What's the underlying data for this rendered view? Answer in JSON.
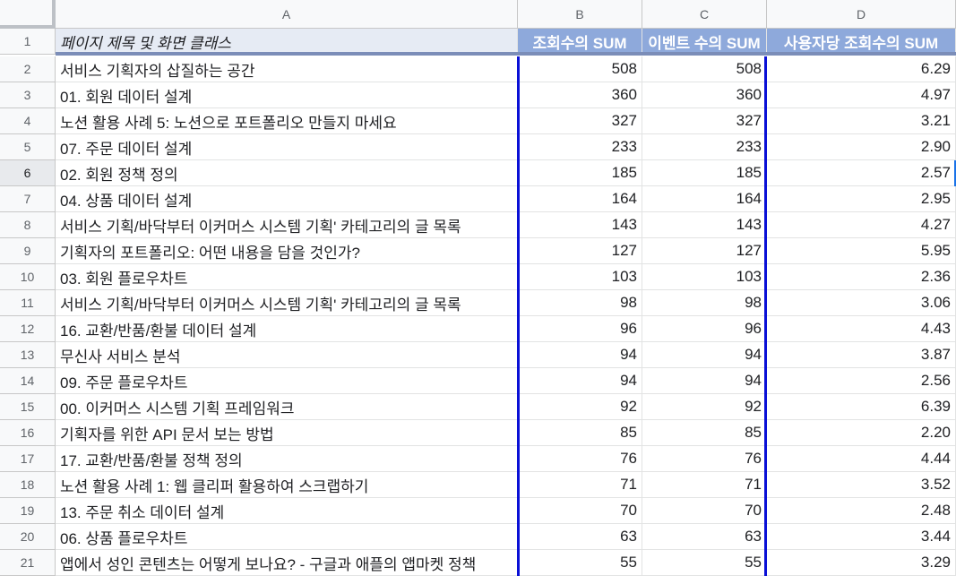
{
  "columns": [
    "A",
    "B",
    "C",
    "D"
  ],
  "header_row": {
    "row_number": "1",
    "a": "페이지 제목 및 화면 클래스",
    "b": "조회수의 SUM",
    "c": "이벤트 수의 SUM",
    "d": "사용자당 조회수의 SUM"
  },
  "rows": [
    {
      "n": "2",
      "title": "서비스 기획자의 삽질하는 공간",
      "views": "508",
      "events": "508",
      "per_user": "6.29"
    },
    {
      "n": "3",
      "title": "01. 회원 데이터 설계",
      "views": "360",
      "events": "360",
      "per_user": "4.97"
    },
    {
      "n": "4",
      "title": "노션 활용 사례 5: 노션으로 포트폴리오 만들지 마세요",
      "views": "327",
      "events": "327",
      "per_user": "3.21"
    },
    {
      "n": "5",
      "title": "07. 주문 데이터 설계",
      "views": "233",
      "events": "233",
      "per_user": "2.90"
    },
    {
      "n": "6",
      "title": "02. 회원 정책 정의",
      "views": "185",
      "events": "185",
      "per_user": "2.57"
    },
    {
      "n": "7",
      "title": "04. 상품 데이터 설계",
      "views": "164",
      "events": "164",
      "per_user": "2.95"
    },
    {
      "n": "8",
      "title": "서비스 기획/바닥부터 이커머스 시스템 기획' 카테고리의 글 목록",
      "views": "143",
      "events": "143",
      "per_user": "4.27"
    },
    {
      "n": "9",
      "title": "기획자의 포트폴리오: 어떤 내용을 담을 것인가?",
      "views": "127",
      "events": "127",
      "per_user": "5.95"
    },
    {
      "n": "10",
      "title": "03. 회원 플로우차트",
      "views": "103",
      "events": "103",
      "per_user": "2.36"
    },
    {
      "n": "11",
      "title": "서비스 기획/바닥부터 이커머스 시스템 기획' 카테고리의 글 목록",
      "views": "98",
      "events": "98",
      "per_user": "3.06"
    },
    {
      "n": "12",
      "title": "16. 교환/반품/환불 데이터 설계",
      "views": "96",
      "events": "96",
      "per_user": "4.43"
    },
    {
      "n": "13",
      "title": "무신사 서비스 분석",
      "views": "94",
      "events": "94",
      "per_user": "3.87"
    },
    {
      "n": "14",
      "title": "09. 주문 플로우차트",
      "views": "94",
      "events": "94",
      "per_user": "2.56"
    },
    {
      "n": "15",
      "title": "00. 이커머스 시스템 기획 프레임워크",
      "views": "92",
      "events": "92",
      "per_user": "6.39"
    },
    {
      "n": "16",
      "title": "기획자를 위한 API 문서 보는 방법",
      "views": "85",
      "events": "85",
      "per_user": "2.20"
    },
    {
      "n": "17",
      "title": "17. 교환/반품/환불 정책 정의",
      "views": "76",
      "events": "76",
      "per_user": "4.44"
    },
    {
      "n": "18",
      "title": "노션 활용 사례 1: 웹 클리퍼 활용하여 스크랩하기",
      "views": "71",
      "events": "71",
      "per_user": "3.52"
    },
    {
      "n": "19",
      "title": "13. 주문 취소 데이터 설계",
      "views": "70",
      "events": "70",
      "per_user": "2.48"
    },
    {
      "n": "20",
      "title": "06. 상품 플로우차트",
      "views": "63",
      "events": "63",
      "per_user": "3.44"
    },
    {
      "n": "21",
      "title": "앱에서 성인 콘텐츠는 어떻게 보나요? - 구글과 애플의 앱마켓 정책",
      "views": "55",
      "events": "55",
      "per_user": "3.29"
    }
  ],
  "active_row": "6",
  "colors": {
    "header_fill": "#8ea9db",
    "header_light": "#e6ebf4",
    "border_blue": "#0a10d6"
  }
}
